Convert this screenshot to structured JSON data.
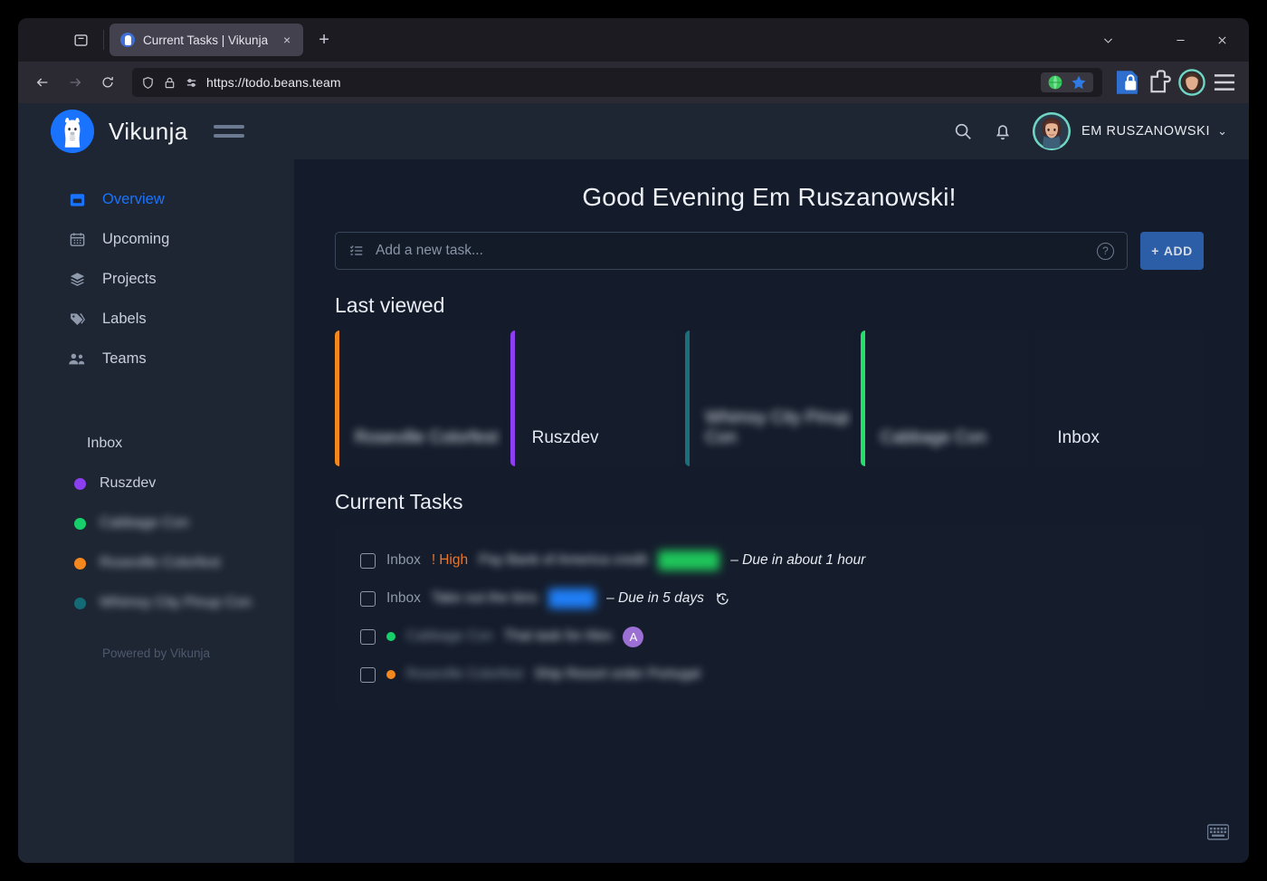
{
  "browser": {
    "tab": {
      "title": "Current Tasks | Vikunja",
      "favicon": "vikunja-icon",
      "close": "×"
    },
    "newtab_label": "+",
    "url": "https://todo.beans.team",
    "window_controls": {
      "chevron": "chevron-down-icon",
      "minimize": "minimize-icon",
      "close": "close-icon"
    },
    "toolbar_icons": [
      "tab-list-icon",
      "back-icon",
      "forward-icon",
      "reload-icon",
      "shield-icon",
      "lock-icon",
      "permissions-icon",
      "translate-icon",
      "bookmark-star-icon",
      "password-manager-icon",
      "extension-icon",
      "account-icon",
      "app-menu-icon"
    ]
  },
  "app": {
    "brand": "Vikunja",
    "header": {
      "search_icon": "search-icon",
      "notifications_icon": "bell-icon",
      "user_name": "EM RUSZANOWSKI",
      "caret": "⌄"
    },
    "greeting": "Good Evening Em Ruszanowski!",
    "add_task": {
      "placeholder": "Add a new task...",
      "help_glyph": "?",
      "button_label": "ADD",
      "button_plus": "+"
    },
    "sidebar": {
      "nav": [
        {
          "label": "Overview",
          "icon": "calendar-day-icon",
          "active": true
        },
        {
          "label": "Upcoming",
          "icon": "calendar-grid-icon",
          "active": false
        },
        {
          "label": "Projects",
          "icon": "layers-icon",
          "active": false
        },
        {
          "label": "Labels",
          "icon": "tag-icon",
          "active": false
        },
        {
          "label": "Teams",
          "icon": "people-icon",
          "active": false
        }
      ],
      "projects": [
        {
          "label": "Inbox",
          "color": null,
          "redacted": false
        },
        {
          "label": "Ruszdev",
          "color": "#8b3ff0",
          "redacted": false
        },
        {
          "label": "Cabbage Con",
          "color": "#17cf6a",
          "redacted": true
        },
        {
          "label": "Roseville Colorfest",
          "color": "#f5871f",
          "redacted": true
        },
        {
          "label": "Whimsy City Pinup Con",
          "color": "#126b75",
          "redacted": true
        }
      ],
      "footer": "Powered by Vikunja"
    },
    "last_viewed": {
      "title": "Last viewed",
      "cards": [
        {
          "label": "Roseville Colorfest",
          "stripe": "#f5871f",
          "redacted": true
        },
        {
          "label": "Ruszdev",
          "stripe": "#8b3ff0",
          "redacted": false
        },
        {
          "label": "Whimsy City Pinup Con",
          "stripe": "#1b6f7d",
          "redacted": true
        },
        {
          "label": "Cabbage Con",
          "stripe": "#22e06a",
          "redacted": true
        },
        {
          "label": "Inbox",
          "stripe": null,
          "redacted": false
        }
      ]
    },
    "current_tasks": {
      "title": "Current Tasks",
      "tasks": [
        {
          "project": "Inbox",
          "project_dot": null,
          "priority": "High",
          "priority_glyph": "!",
          "title": "Pay Bank of America credit",
          "redacted": true,
          "chip_color": "#1ec55a",
          "chip_width": 68,
          "due": "– Due in about 1 hour",
          "repeat": false,
          "assignee": null
        },
        {
          "project": "Inbox",
          "project_dot": null,
          "priority": null,
          "priority_glyph": null,
          "title": "Take out the bins",
          "redacted": true,
          "chip_color": "#1f7ef5",
          "chip_width": 52,
          "due": "– Due in 5 days",
          "repeat": true,
          "assignee": null
        },
        {
          "project": "Cabbage Con",
          "project_dot": "#17cf6a",
          "priority": null,
          "priority_glyph": null,
          "title": "That task for Alex",
          "redacted": true,
          "chip_color": null,
          "chip_width": 0,
          "due": null,
          "repeat": false,
          "assignee": "A"
        },
        {
          "project": "Roseville Colorfest",
          "project_dot": "#f5871f",
          "priority": null,
          "priority_glyph": null,
          "title": "Ship Resort order Portugal",
          "redacted": true,
          "chip_color": null,
          "chip_width": 0,
          "due": null,
          "repeat": false,
          "assignee": null
        }
      ]
    },
    "keyboard_shortcuts_icon": "keyboard-icon"
  }
}
